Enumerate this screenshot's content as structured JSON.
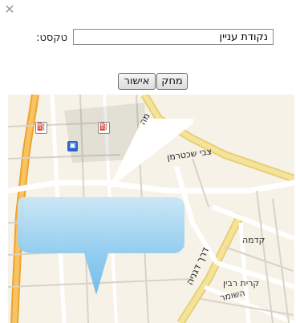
{
  "dialog": {
    "close_symbol": "✕",
    "label": "טקסט:",
    "input_value": "נקודת עניין",
    "buttons": {
      "ok": "אישור",
      "delete": "מחק"
    }
  },
  "map": {
    "street_labels": {
      "tzvi": "צבי שכטרמן",
      "derech_dganiya": "דרך דגניה",
      "ne": "מה"
    },
    "place_labels": {
      "kdma": "קדמה",
      "kiryat_rabin": "קרית רבין",
      "hashomer": "השומר"
    },
    "icons": [
      "fuel-icon",
      "bus-icon"
    ]
  }
}
